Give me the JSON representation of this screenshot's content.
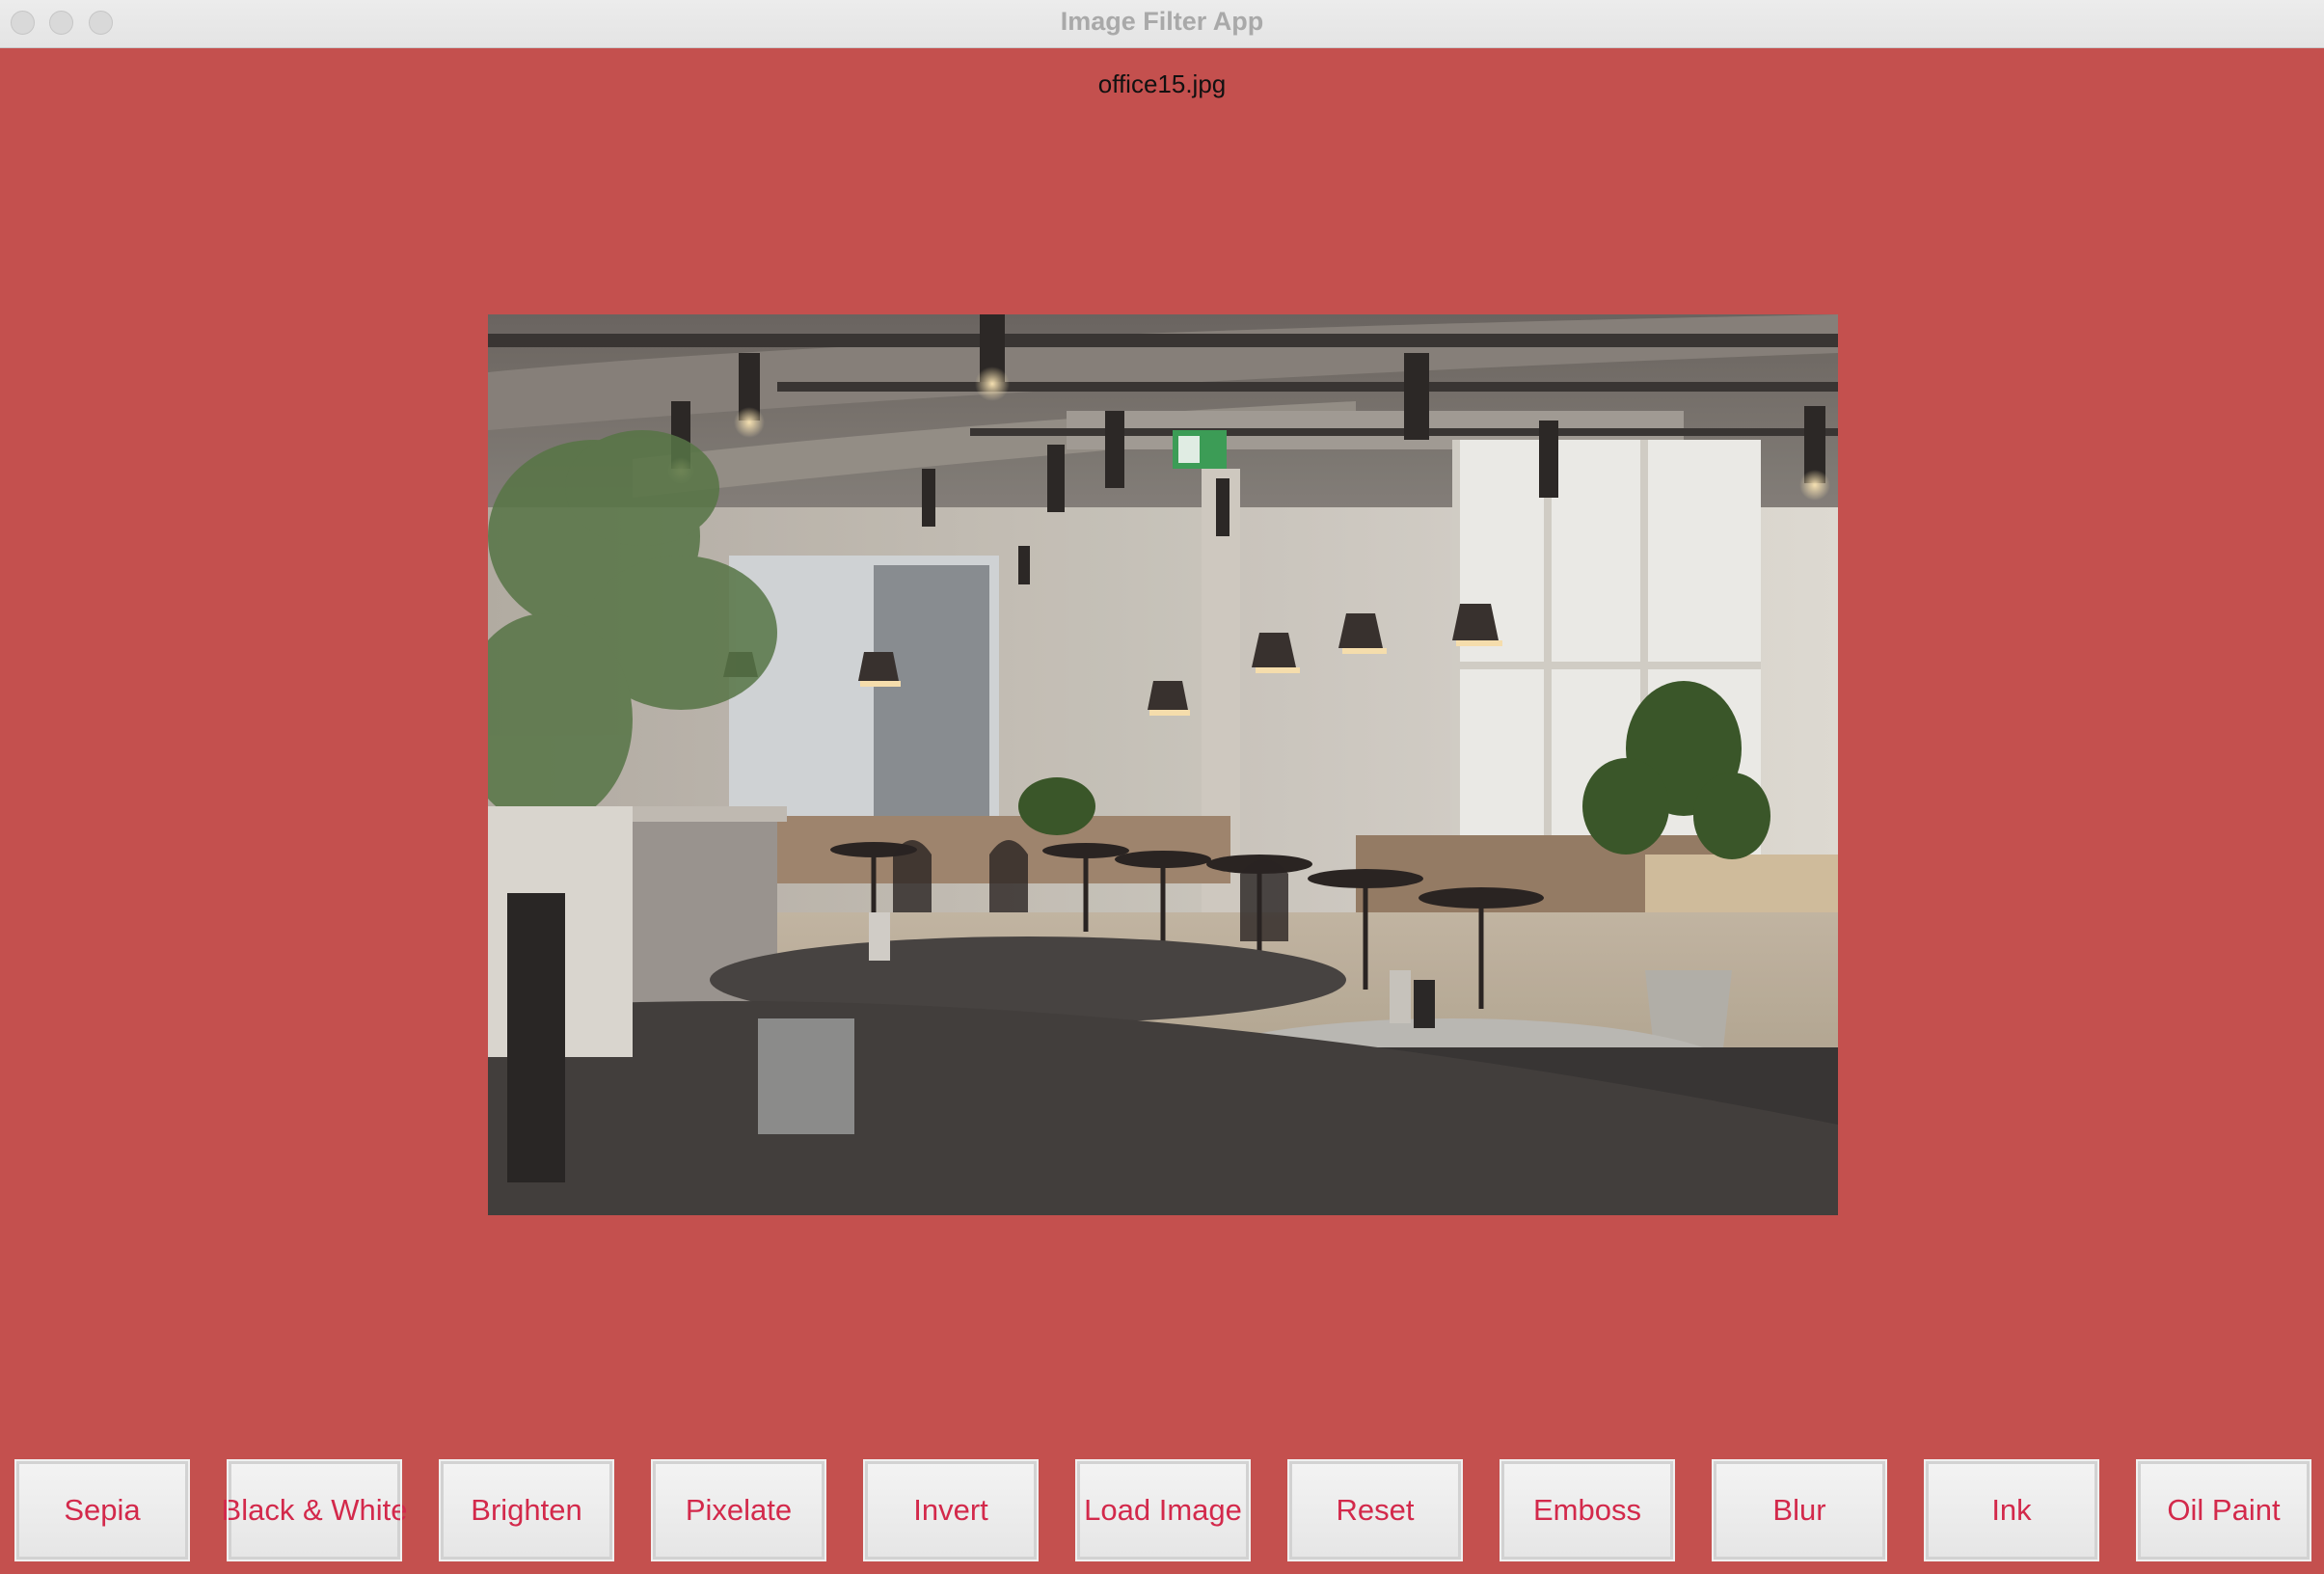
{
  "window": {
    "title": "Image Filter App"
  },
  "image": {
    "filename": "office15.jpg",
    "alt": "office cafeteria interior photo"
  },
  "buttons": [
    {
      "label": "Sepia"
    },
    {
      "label": "Black & White"
    },
    {
      "label": "Brighten"
    },
    {
      "label": "Pixelate"
    },
    {
      "label": "Invert"
    },
    {
      "label": "Load Image"
    },
    {
      "label": "Reset"
    },
    {
      "label": "Emboss"
    },
    {
      "label": "Blur"
    },
    {
      "label": "Ink"
    },
    {
      "label": "Oil Paint"
    }
  ],
  "colors": {
    "background": "#c4504e",
    "button_text": "#d3294b"
  }
}
